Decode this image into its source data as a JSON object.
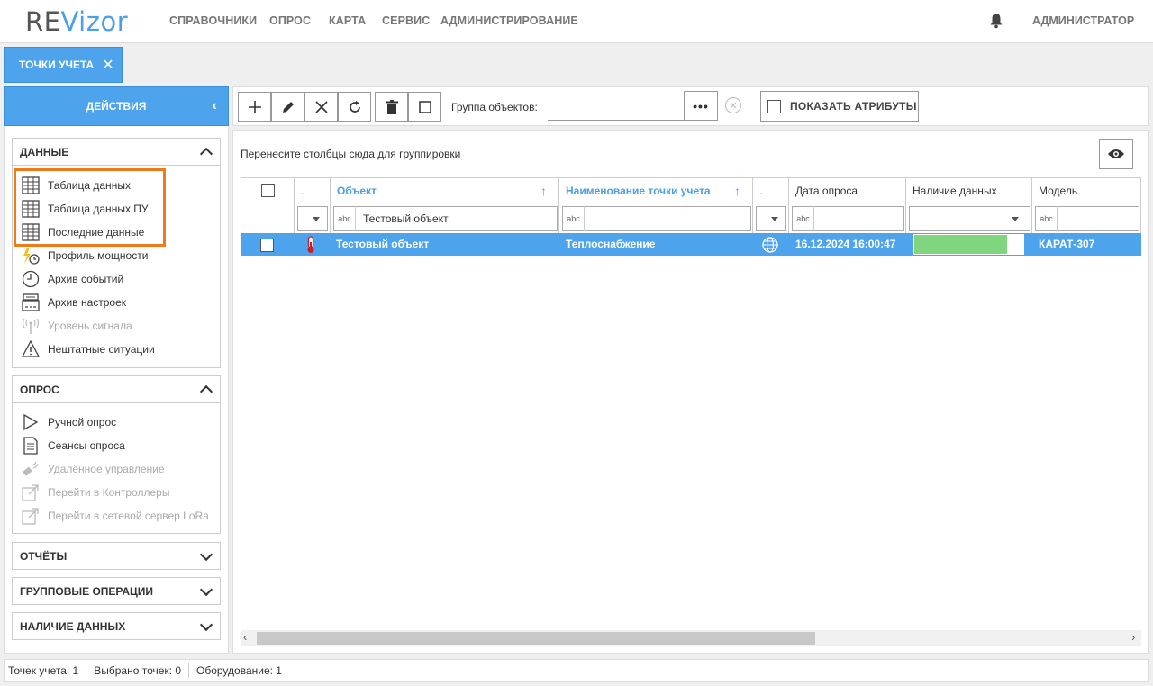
{
  "app": {
    "logo_main": "RE",
    "logo_accent": "Vizor"
  },
  "nav": {
    "items": [
      "СПРАВОЧНИКИ",
      "ОПРОС",
      "КАРТА",
      "СЕРВИС",
      "АДМИНИСТРИРОВАНИЕ"
    ],
    "user": "АДМИНИСТРАТОР",
    "bell_icon": "bell-icon"
  },
  "tab": {
    "label": "ТОЧКИ УЧЕТА",
    "close": "✕"
  },
  "actions": {
    "label": "ДЕЙСТВИЯ",
    "collapse": "‹"
  },
  "sections": {
    "data": {
      "title": "ДАННЫЕ",
      "items": [
        {
          "label": "Таблица данных",
          "icon": "table-icon"
        },
        {
          "label": "Таблица данных ПУ",
          "icon": "table-icon"
        },
        {
          "label": "Последние данные",
          "icon": "table-icon"
        },
        {
          "label": "Профиль мощности",
          "icon": "power-profile-icon"
        },
        {
          "label": "Архив событий",
          "icon": "clock-icon"
        },
        {
          "label": "Архив настроек",
          "icon": "settings-archive-icon"
        },
        {
          "label": "Уровень сигнала",
          "icon": "signal-icon"
        },
        {
          "label": "Нештатные ситуации",
          "icon": "warning-icon"
        }
      ]
    },
    "poll": {
      "title": "ОПРОС",
      "items": [
        {
          "label": "Ручной опрос",
          "icon": "play-icon"
        },
        {
          "label": "Сеансы опроса",
          "icon": "document-icon"
        },
        {
          "label": "Удалённое управление",
          "icon": "remote-icon"
        },
        {
          "label": "Перейти в Контроллеры",
          "icon": "external-link-icon"
        },
        {
          "label": "Перейти в сетевой сервер LoRa",
          "icon": "external-link-icon"
        }
      ]
    },
    "reports": {
      "title": "ОТЧЁТЫ"
    },
    "group_ops": {
      "title": "ГРУППОВЫЕ ОПЕРАЦИИ"
    },
    "presence": {
      "title": "НАЛИЧИЕ ДАННЫХ"
    }
  },
  "toolbar": {
    "group_label": "Группа объектов:",
    "group_value": "",
    "dots": "•••",
    "clear": "✕",
    "show_attributes": "ПОКАЗАТЬ АТРИБУТЫ"
  },
  "grid": {
    "group_hint": "Перенесите столбцы сюда для группировки",
    "columns": [
      "",
      ".",
      "Объект",
      "Наименование точки учета",
      ".",
      "Дата опроса",
      "Наличие данных",
      "Модель"
    ],
    "filter_object": "Тестовый объект",
    "abc": "abc",
    "row": {
      "object": "Тестовый объект",
      "point_name": "Теплоснабжение",
      "poll_date": "16.12.2024 16:00:47",
      "presence_fraction": 0.85,
      "model": "КАРАТ-307"
    }
  },
  "status": {
    "points": "Точек учета: 1",
    "selected": "Выбрано точек: 0",
    "equipment": "Оборудование: 1"
  },
  "colors": {
    "accent": "#4da3ec",
    "highlight": "#f07b16",
    "presence": "#7fd67f"
  }
}
